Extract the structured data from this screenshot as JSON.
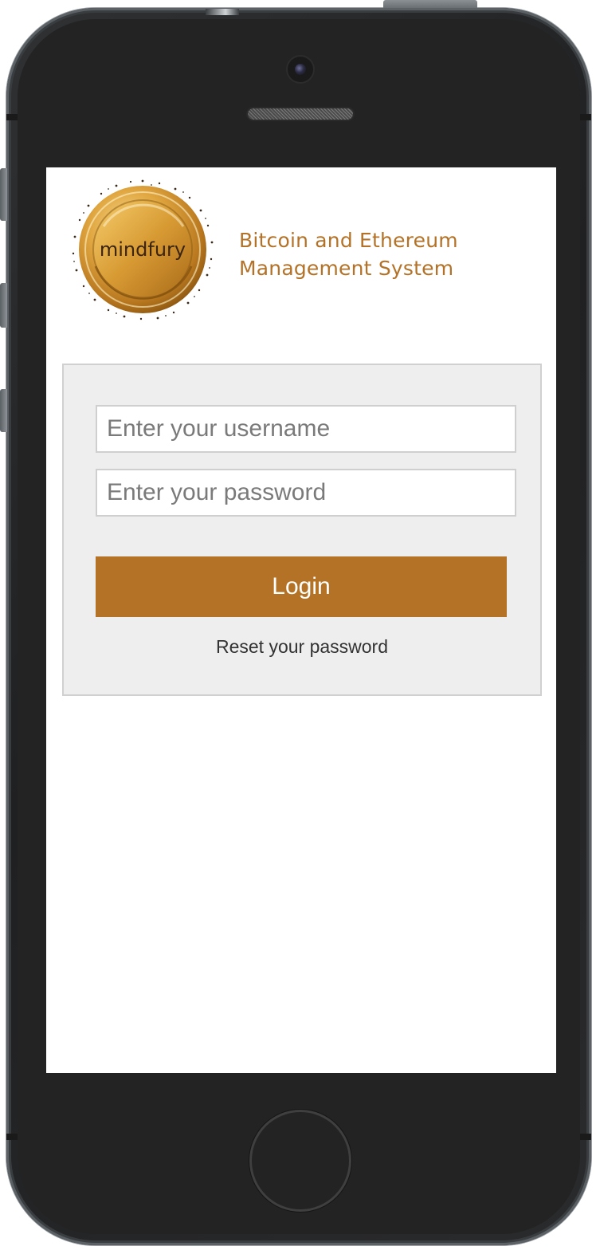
{
  "app": {
    "logo_text": "mindfury",
    "title_line1": "Bitcoin and Ethereum",
    "title_line2": "Management System"
  },
  "login": {
    "username_placeholder": "Enter your username",
    "password_placeholder": "Enter your password",
    "login_label": "Login",
    "reset_label": "Reset your password"
  },
  "colors": {
    "accent": "#b37225",
    "panel_bg": "#eeeeee",
    "device_body": "#232323"
  },
  "icons": {
    "logo": "gold-coin-logo",
    "camera": "front-camera",
    "speaker": "earpiece-speaker",
    "home": "home-button"
  }
}
